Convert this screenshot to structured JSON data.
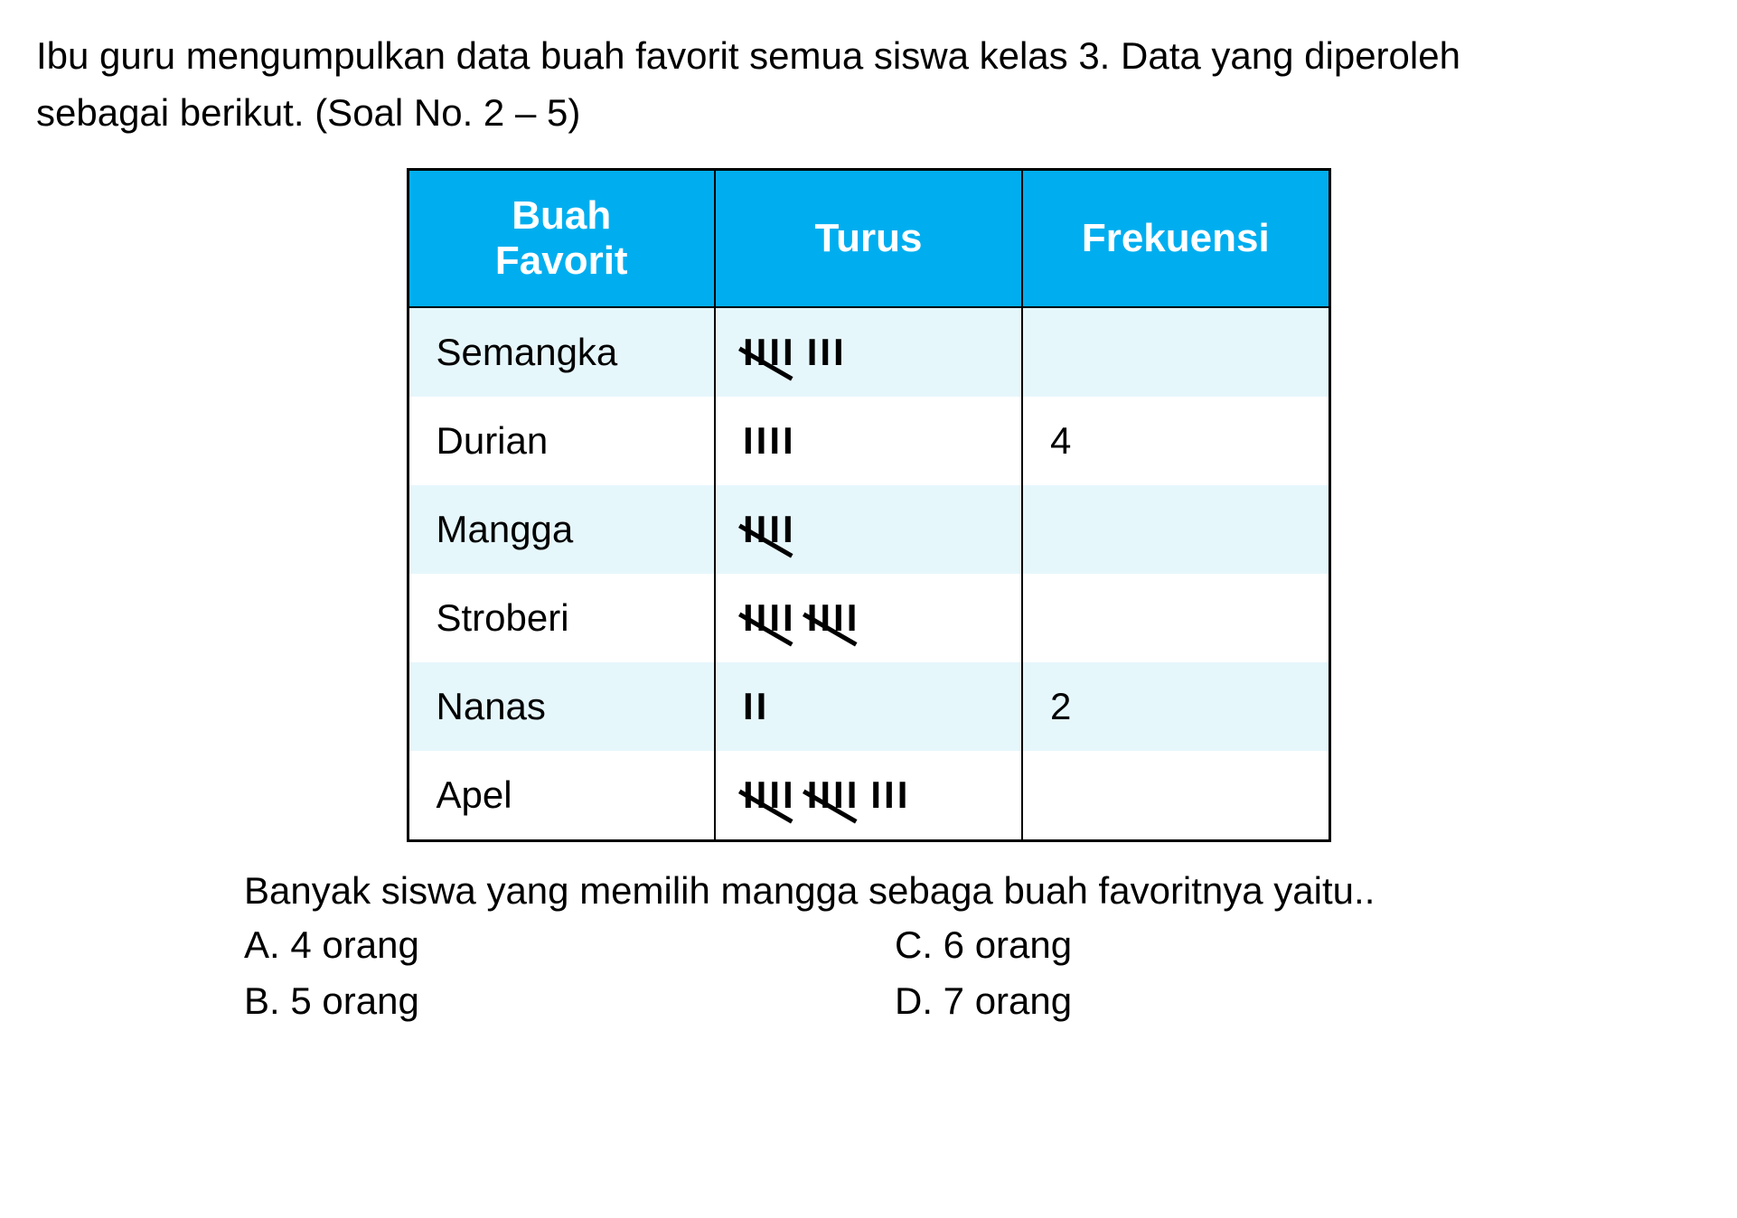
{
  "intro": {
    "line1": "Ibu guru mengumpulkan data buah favorit semua siswa kelas 3. Data yang diperoleh",
    "line2": "sebagai berikut. (Soal No. 2 – 5)"
  },
  "table": {
    "headers": {
      "col1_line1": "Buah",
      "col1_line2": "Favorit",
      "col2": "Turus",
      "col3": "Frekuensi"
    },
    "rows": [
      {
        "fruit": "Semangka",
        "tally_fives": 1,
        "tally_ones": 3,
        "frequency": ""
      },
      {
        "fruit": "Durian",
        "tally_fives": 0,
        "tally_ones": 4,
        "frequency": "4"
      },
      {
        "fruit": "Mangga",
        "tally_fives": 1,
        "tally_ones": 0,
        "frequency": ""
      },
      {
        "fruit": "Stroberi",
        "tally_fives": 2,
        "tally_ones": 0,
        "frequency": ""
      },
      {
        "fruit": "Nanas",
        "tally_fives": 0,
        "tally_ones": 2,
        "frequency": "2"
      },
      {
        "fruit": "Apel",
        "tally_fives": 2,
        "tally_ones": 3,
        "frequency": ""
      }
    ]
  },
  "question": {
    "text": "Banyak siswa yang memilih mangga sebaga buah favoritnya yaitu..",
    "options": {
      "a": "A. 4 orang",
      "b": "B. 5 orang",
      "c": "C. 6 orang",
      "d": "D. 7 orang"
    }
  },
  "chart_data": {
    "type": "table",
    "title": "Data buah favorit siswa kelas 3",
    "columns": [
      "Buah Favorit",
      "Turus",
      "Frekuensi"
    ],
    "data": [
      {
        "fruit": "Semangka",
        "tally_count": 8,
        "frequency_shown": null
      },
      {
        "fruit": "Durian",
        "tally_count": 4,
        "frequency_shown": 4
      },
      {
        "fruit": "Mangga",
        "tally_count": 5,
        "frequency_shown": null
      },
      {
        "fruit": "Stroberi",
        "tally_count": 10,
        "frequency_shown": null
      },
      {
        "fruit": "Nanas",
        "tally_count": 2,
        "frequency_shown": 2
      },
      {
        "fruit": "Apel",
        "tally_count": 13,
        "frequency_shown": null
      }
    ]
  }
}
